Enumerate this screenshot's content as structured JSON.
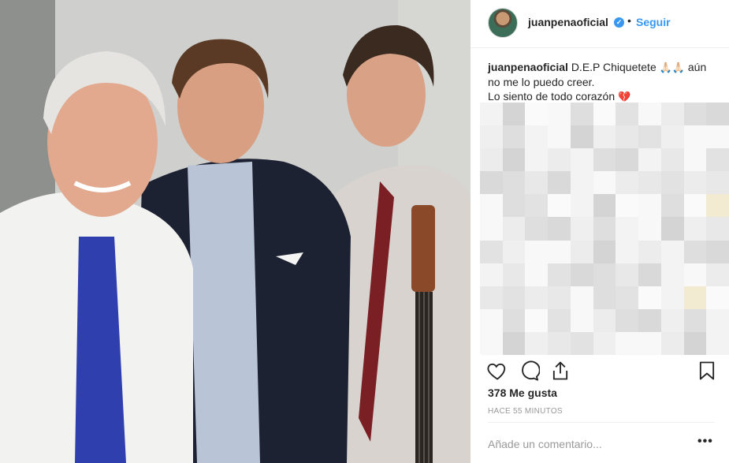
{
  "post": {
    "photo_alt": "Three men posing together, one holding a guitar",
    "header": {
      "username": "juanpenaoficial",
      "verified": true,
      "separator": "•",
      "follow_label": "Seguir"
    },
    "caption": {
      "username": "juanpenaoficial",
      "text_line1": "D.E.P Chiquetete",
      "emoji1": "🙏🏻🙏🏻",
      "text_line1_end": "aún no me lo puedo creer.",
      "text_line2": "Lo siento de todo corazón",
      "emoji2": "💔"
    },
    "likes": "378 Me gusta",
    "timestamp": "HACE 55 MINUTOS",
    "comment_placeholder": "Añade un comentario...",
    "more_label": "•••",
    "icons": {
      "like": "heart-icon",
      "comment": "comment-icon",
      "share": "share-icon",
      "save": "bookmark-icon"
    },
    "colors": {
      "accent": "#3897f0",
      "text": "#262626",
      "muted": "#999999",
      "divider": "#efefef"
    }
  }
}
